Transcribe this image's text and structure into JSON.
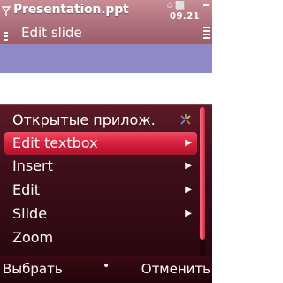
{
  "window": {
    "app_title": "Presentation.ppt",
    "subtitle": "Edit slide",
    "clock": "09.21",
    "status_glyphs": "✩ ⬜"
  },
  "slide": {
    "band_color": "#8f89c8"
  },
  "menu": {
    "items": [
      {
        "label": "Открытые прилож.",
        "icon": "multitask-star-icon",
        "submenu": false,
        "selected": false
      },
      {
        "label": "Edit textbox",
        "submenu": true,
        "selected": true
      },
      {
        "label": "Insert",
        "submenu": true,
        "selected": false
      },
      {
        "label": "Edit",
        "submenu": true,
        "selected": false
      },
      {
        "label": "Slide",
        "submenu": true,
        "selected": false
      },
      {
        "label": "Zoom",
        "submenu": false,
        "selected": false
      }
    ],
    "arrow_glyph": "▶"
  },
  "softkeys": {
    "left": "Выбрать",
    "middle": "•",
    "right": "Отменить"
  },
  "colors": {
    "title_bar": "#b27480",
    "menu_bg": "#3e0f1a",
    "highlight": "#d81f3c"
  }
}
